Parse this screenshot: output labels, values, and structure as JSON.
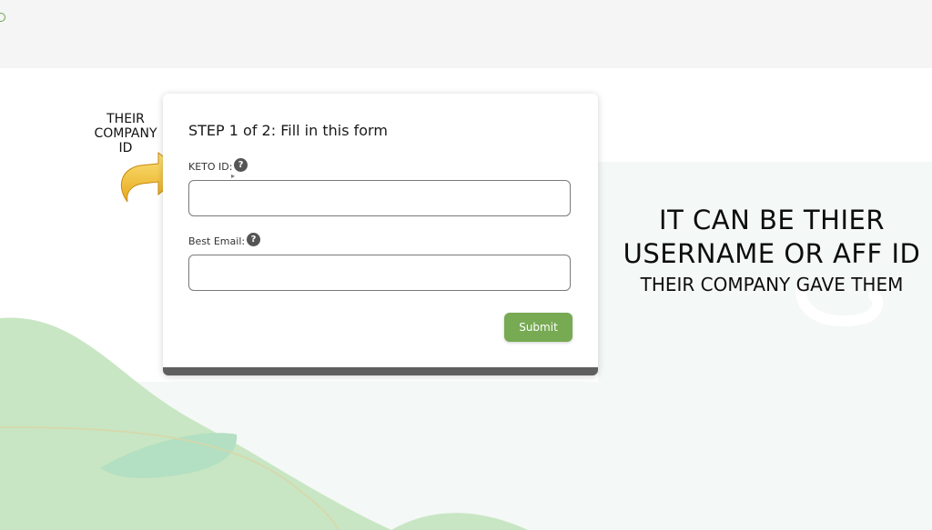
{
  "annotations": {
    "left_lines": [
      "THEIR",
      "COMPANY",
      "ID"
    ],
    "right_line1": "IT CAN BE THIER",
    "right_line2": "USERNAME OR AFF ID",
    "right_line3": "THEIR COMPANY GAVE THEM"
  },
  "form": {
    "title": "STEP 1 of 2: Fill in this form",
    "keto_id": {
      "label": "KETO ID:",
      "value": "",
      "placeholder": "",
      "help_icon": "question-mark"
    },
    "email": {
      "label": "Best Email:",
      "value": "",
      "placeholder": "",
      "help_icon": "question-mark"
    },
    "submit_label": "Submit",
    "help_glyph": "?"
  },
  "colors": {
    "accent_green": "#77aa53",
    "footer_bar": "#5f5f5f",
    "blob_green": "#c8e6c3",
    "arrow_yellow": "#f2c531"
  }
}
